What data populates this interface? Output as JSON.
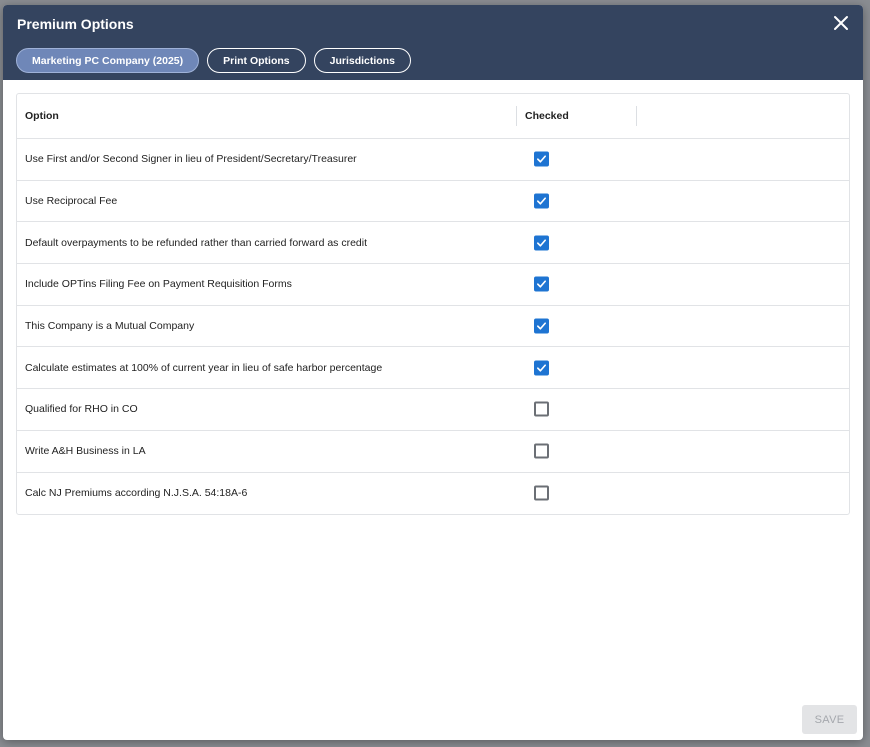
{
  "dialog": {
    "title": "Premium Options",
    "close_icon": "close-icon"
  },
  "tabs": [
    {
      "label": "Marketing PC Company (2025)",
      "active": true
    },
    {
      "label": "Print Options",
      "active": false
    },
    {
      "label": "Jurisdictions",
      "active": false
    }
  ],
  "table": {
    "headers": {
      "option": "Option",
      "checked": "Checked"
    },
    "rows": [
      {
        "label": "Use First and/or Second Signer in lieu of President/Secretary/Treasurer",
        "checked": true
      },
      {
        "label": "Use Reciprocal Fee",
        "checked": true
      },
      {
        "label": "Default overpayments to be refunded rather than carried forward as credit",
        "checked": true
      },
      {
        "label": "Include OPTins Filing Fee on Payment Requisition Forms",
        "checked": true
      },
      {
        "label": "This Company is a Mutual Company",
        "checked": true
      },
      {
        "label": "Calculate estimates at 100% of current year in lieu of safe harbor percentage",
        "checked": true
      },
      {
        "label": "Qualified for RHO in CO",
        "checked": false
      },
      {
        "label": "Write A&H Business in LA",
        "checked": false
      },
      {
        "label": "Calc NJ Premiums according N.J.S.A. 54:18A-6",
        "checked": false
      }
    ]
  },
  "footer": {
    "save_label": "SAVE",
    "save_disabled": true
  },
  "colors": {
    "header": "#34445f",
    "accent": "#1e74d2",
    "active_tab": "#6f87b8"
  }
}
